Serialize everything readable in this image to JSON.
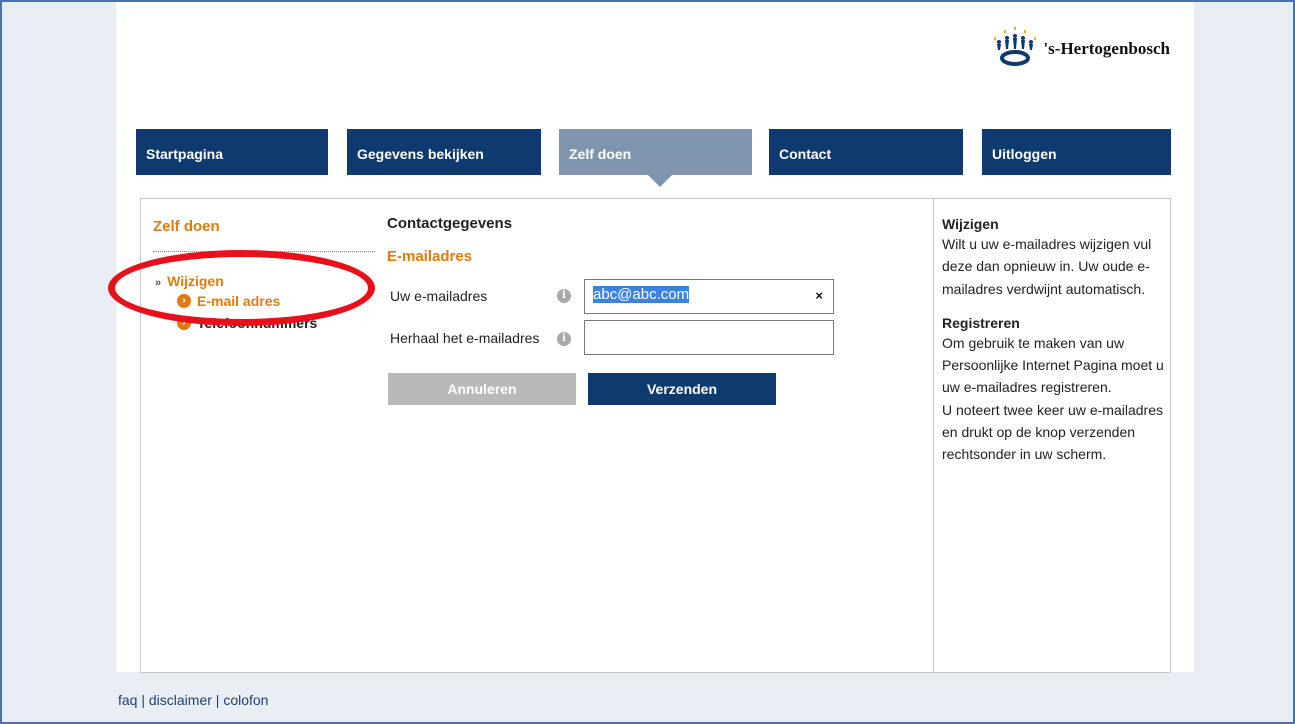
{
  "logo": {
    "text": "'s-Hertogenbosch"
  },
  "nav": {
    "items": [
      {
        "label": "Startpagina"
      },
      {
        "label": "Gegevens bekijken"
      },
      {
        "label": "Zelf doen"
      },
      {
        "label": "Contact"
      },
      {
        "label": "Uitloggen"
      }
    ],
    "active": "Zelf doen"
  },
  "sidebar": {
    "title": "Zelf doen",
    "section": "Wijzigen",
    "items": [
      {
        "label": "E-mail adres",
        "active": true
      },
      {
        "label": "Telefoonnummers",
        "active": false
      }
    ]
  },
  "main": {
    "title": "Contactgegevens",
    "subtitle": "E-mailadres",
    "fields": [
      {
        "label": "Uw e-mailadres",
        "value": "abc@abc.com",
        "clear": "×"
      },
      {
        "label": "Herhaal het e-mailadres",
        "value": ""
      }
    ],
    "cancel_label": "Annuleren",
    "submit_label": "Verzenden"
  },
  "help": {
    "sections": [
      {
        "heading": "Wijzigen",
        "text": "Wilt u uw e-mailadres wijzigen vul deze dan opnieuw in. Uw oude e-mailadres verdwijnt automatisch."
      },
      {
        "heading": "Registreren",
        "text": "Om gebruik te maken van uw Persoonlijke Internet Pagina moet u uw e-mailadres registreren.",
        "text2": "U noteert twee keer uw e-mailadres en drukt op de knop verzenden rechtsonder in uw scherm."
      }
    ]
  },
  "footer": {
    "links": [
      {
        "label": "faq"
      },
      {
        "label": "disclaimer"
      },
      {
        "label": "colofon"
      }
    ],
    "separator": "|"
  },
  "colors": {
    "nav_bg": "#0e3a70",
    "nav_active": "#7f95ad",
    "accent_orange": "#e07b12",
    "highlight_red": "#e8101b",
    "selection_blue": "#3b83e0"
  }
}
